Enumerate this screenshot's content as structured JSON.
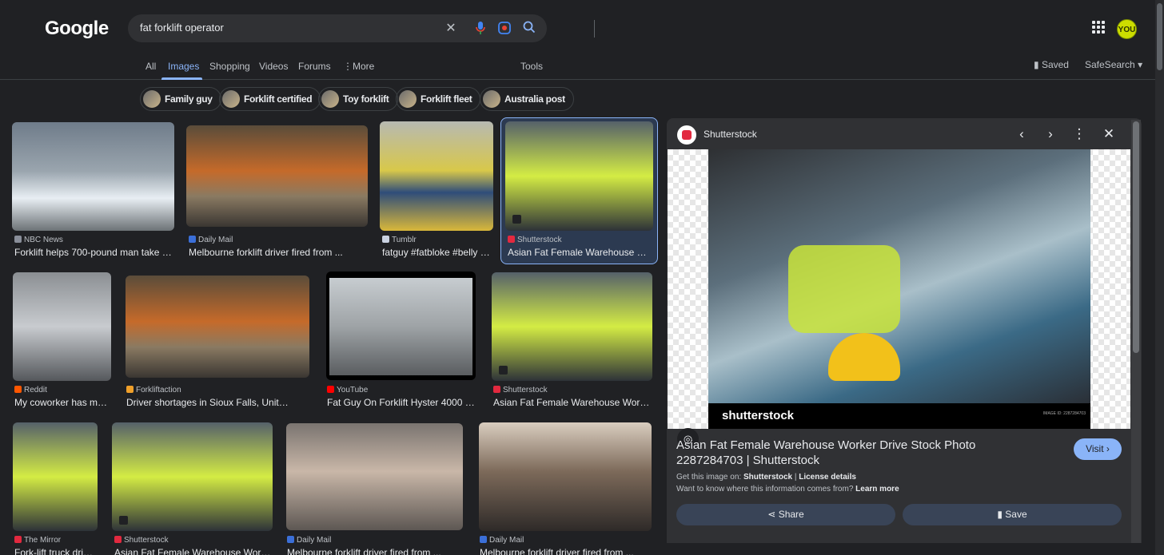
{
  "header": {
    "logo": "Google",
    "search_value": "fat forklift operator",
    "avatar_label": "YOU"
  },
  "nav": {
    "tabs": [
      "All",
      "Images",
      "Shopping",
      "Videos",
      "Forums",
      "More"
    ],
    "tools": "Tools",
    "saved": "Saved",
    "safesearch": "SafeSearch"
  },
  "chips": [
    "Family guy",
    "Forklift certified",
    "Toy forklift",
    "Forklift fleet",
    "Australia post"
  ],
  "results": [
    {
      "source": "NBC News",
      "caption": "Forklift helps 700-pound man take rar...",
      "color": "#8a8f9a"
    },
    {
      "source": "Daily Mail",
      "caption": "Melbourne forklift driver fired from ...",
      "color": "#3b6fd8"
    },
    {
      "source": "Tumblr",
      "caption": "fatguy #fatbloke #belly #o...",
      "color": "#c9d1e0"
    },
    {
      "source": "Shutterstock",
      "caption": "Asian Fat Female Warehouse Wor...",
      "color": "#e2293f"
    },
    {
      "source": "Reddit",
      "caption": "My coworker has mad...",
      "color": "#ff5700"
    },
    {
      "source": "Forkliftaction",
      "caption": "Driver shortages in Sioux Falls, United ...",
      "color": "#f0a02a"
    },
    {
      "source": "YouTube",
      "caption": "Fat Guy On Forklift Hyster 4000 Lb ...",
      "color": "#ff0000"
    },
    {
      "source": "Shutterstock",
      "caption": "Asian Fat Female Warehouse Worker ...",
      "color": "#e2293f"
    },
    {
      "source": "The Mirror",
      "caption": "Fork-lift truck drive...",
      "color": "#e2293f"
    },
    {
      "source": "Shutterstock",
      "caption": "Asian Fat Female Warehouse Worker...",
      "color": "#e2293f"
    },
    {
      "source": "Daily Mail",
      "caption": "Melbourne forklift driver fired from ...",
      "color": "#3b6fd8"
    },
    {
      "source": "Daily Mail",
      "caption": "Melbourne forklift driver fired from ...",
      "color": "#3b6fd8"
    }
  ],
  "panel": {
    "source": "Shutterstock",
    "watermark": "shutterstock",
    "image_id": "IMAGE ID: 2287284703",
    "title": "Asian Fat Female Warehouse Worker Drive Stock Photo 2287284703 | Shutterstock",
    "visit": "Visit",
    "get_image_prefix": "Get this image on:",
    "get_image_site": "Shutterstock",
    "license": "License details",
    "info_question": "Want to know where this information comes from?",
    "learn_more": "Learn more",
    "share": "Share",
    "save": "Save"
  }
}
